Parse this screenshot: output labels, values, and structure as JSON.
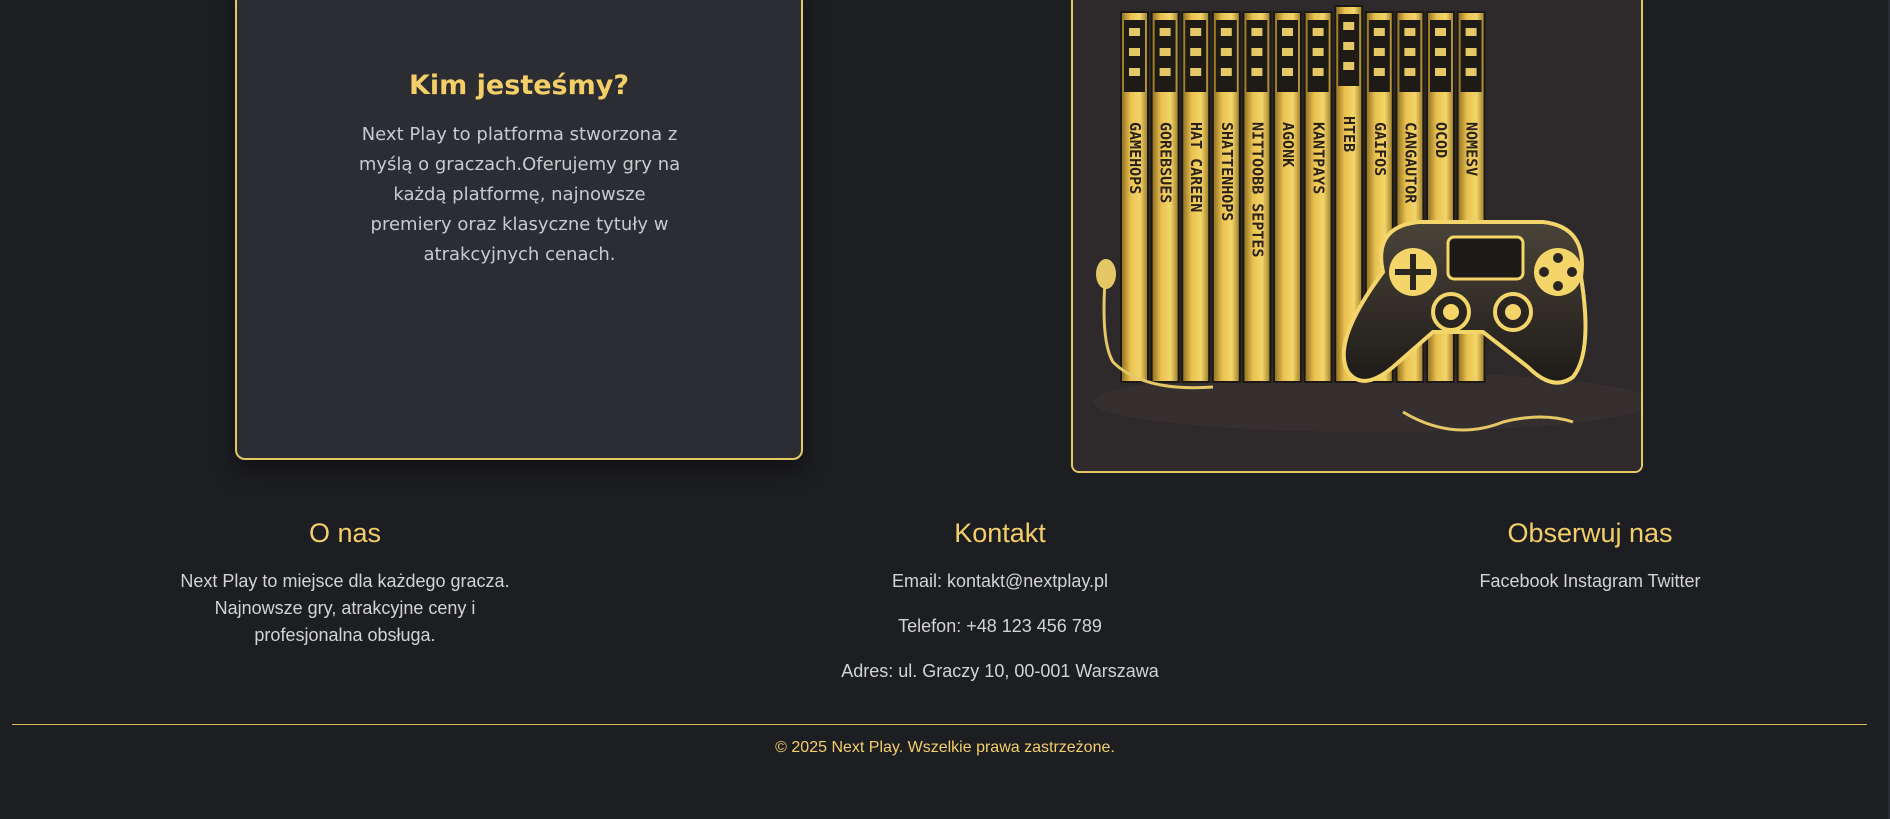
{
  "about": {
    "title": "Kim jesteśmy?",
    "text": "Next Play to platforma stworzona z myślą o graczach.Oferujemy gry na każdą platformę, najnowsze premiery oraz klasyczne tytuły w atrakcyjnych cenach."
  },
  "image": {
    "icon": "game-library-illustration",
    "spine_texts": [
      "GAMEHOPS",
      "GOREBSUES",
      "HAT CAREEN",
      "SHATTENHOPS",
      "NITTOOBB SEPTES",
      "AGONK",
      "KANTPAYS",
      "HTEB",
      "GAIFOS",
      "CANGAUTOR",
      "OCOD",
      "NOMESV"
    ]
  },
  "footer": {
    "onas": {
      "title": "O nas",
      "text": "Next Play to miejsce dla każdego gracza. Najnowsze gry, atrakcyjne ceny i profesjonalna obsługa."
    },
    "kontakt": {
      "title": "Kontakt",
      "email": "Email: kontakt@nextplay.pl",
      "phone": "Telefon: +48 123 456 789",
      "address": "Adres: ul. Graczy 10, 00-001 Warszawa"
    },
    "social": {
      "title": "Obserwuj nas",
      "facebook": "Facebook",
      "instagram": "Instagram",
      "twitter": "Twitter"
    },
    "copyright": "© 2025 Next Play. Wszelkie prawa zastrzeżone."
  },
  "colors": {
    "background": "#1d1e22",
    "accent": "#f4cf67",
    "card": "#2b2d33"
  }
}
